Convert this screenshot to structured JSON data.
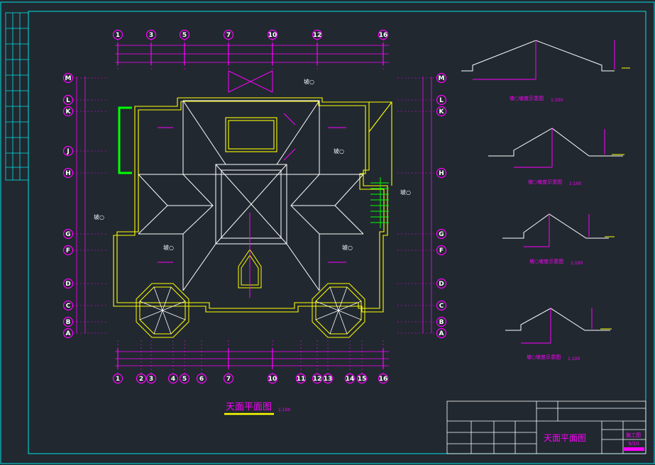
{
  "plan": {
    "title": "天面平面图",
    "scale": "1:100",
    "top_axes": [
      "1",
      "3",
      "5",
      "7",
      "10",
      "12",
      "16"
    ],
    "bottom_axes": [
      "1",
      "2",
      "3",
      "4",
      "5",
      "6",
      "7",
      "10",
      "11",
      "12",
      "13",
      "14",
      "15",
      "16"
    ],
    "left_axes": [
      "M",
      "L",
      "K",
      "J",
      "H",
      "G",
      "F",
      "D",
      "C",
      "B",
      "A"
    ],
    "right_axes": [
      "M",
      "L",
      "K",
      "H",
      "G",
      "F",
      "D",
      "C",
      "B",
      "A"
    ],
    "slope_mark": "坡○"
  },
  "sections": [
    {
      "title": "坡○坡度示意图",
      "scale": "1:100"
    },
    {
      "title": "坡○坡度示意图",
      "scale": "1:100"
    },
    {
      "title": "坡○坡度示意图",
      "scale": "1:100"
    },
    {
      "title": "坡○坡度示意图",
      "scale": "1:100"
    }
  ],
  "title_block": {
    "drawing_name": "天面平面图",
    "stage": "施工图",
    "sheet": "9/10"
  },
  "colors": {
    "background": "#212830",
    "border": "#00e5e5",
    "annotation": "#ff00ff",
    "roof_lines": "#ffffff",
    "walls": "#ffff00",
    "highlight": "#00ff00"
  }
}
